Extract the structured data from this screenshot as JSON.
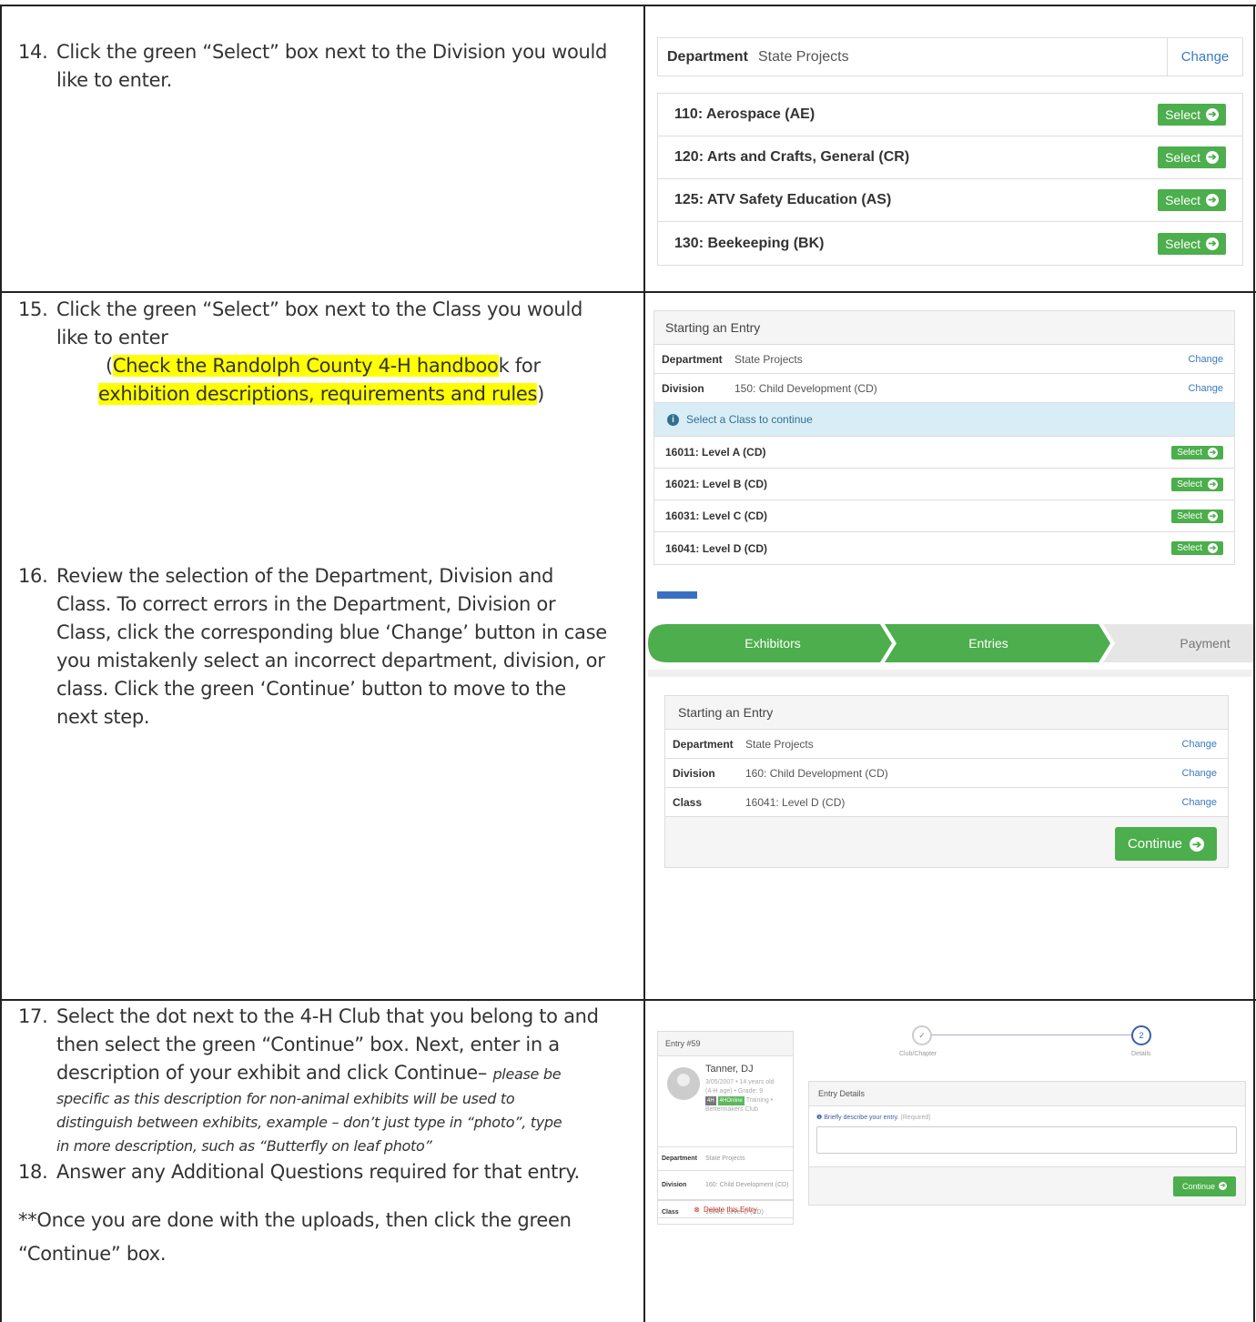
{
  "steps": {
    "s14": {
      "num": "14.",
      "line1": "Click the green “Select” box next to the Division you would",
      "line2": "like to enter."
    },
    "s15": {
      "num": "15.",
      "line1": "Click the green “Select” box next to the Class you would",
      "line2": "like to enter",
      "note_open": "(",
      "note_hl1": "Check the Randolph County 4-H  handboo",
      "note_plain": "k for",
      "note_hl2": "exhibition descriptions, requirements and rules",
      "note_close": ")"
    },
    "s16": {
      "num": "16.",
      "lines": [
        "Review the selection of the Department, Division and",
        "Class.  To correct errors in the Department, Division or",
        "Class, click the corresponding blue ‘Change’ button in case",
        "you mistakenly select an incorrect department, division, or",
        "class. Click the green ‘Continue’ button to move to the",
        "next step."
      ]
    },
    "s17": {
      "num": "17.",
      "lines": [
        "Select the dot next to the 4-H Club that you belong to and",
        "then select the green “Continue” box. Next, enter in a"
      ],
      "line3a": "description of your exhibit  and click Continue– ",
      "line3b": "please be",
      "ital": [
        "specific as this description for non-animal exhibits will be used to",
        "distinguish between exhibits, example – don’t just type in “photo”, type",
        "in more description, such as “Butterfly on leaf photo”"
      ]
    },
    "s18": {
      "num": "18.",
      "line": "Answer any Additional Questions required for that entry."
    },
    "final": {
      "line1": "**Once you are done with the uploads, then click the green",
      "line2": "“Continue” box."
    }
  },
  "panel1": {
    "dept_label": "Department",
    "dept_value": "State Projects",
    "change": "Change",
    "select": "Select",
    "divisions": [
      "110: Aerospace (AE)",
      "120: Arts and Crafts, General (CR)",
      "125: ATV Safety Education (AS)",
      "130: Beekeeping (BK)"
    ]
  },
  "panel2": {
    "title": "Starting an Entry",
    "dept_label": "Department",
    "dept_value": "State Projects",
    "div_label": "Division",
    "div_value": "150: Child Development (CD)",
    "change": "Change",
    "info": "Select a Class to continue",
    "select": "Select",
    "classes": [
      "16011: Level A (CD)",
      "16021: Level B (CD)",
      "16031: Level C (CD)",
      "16041: Level D (CD)"
    ]
  },
  "progress": {
    "steps": [
      "Exhibitors",
      "Entries",
      "Payment"
    ],
    "colors": {
      "done": "#4cae4c",
      "todo": "#e6e6e6"
    }
  },
  "panel3": {
    "title": "Starting an Entry",
    "dept_label": "Department",
    "dept_value": "State Projects",
    "div_label": "Division",
    "div_value": "160: Child Development (CD)",
    "class_label": "Class",
    "class_value": "16041: Level D (CD)",
    "change": "Change",
    "continue": "Continue"
  },
  "panel4": {
    "entry_title": "Entry #59",
    "name": "Tanner, DJ",
    "meta1": "3/05/2007 • 14 years old",
    "meta2": "(4-H age) • Grade: 9",
    "badge1": "4H",
    "badge2": "4HOnline",
    "meta3": "Training •",
    "meta4": "Bettermakers Club",
    "dept_label": "Department",
    "dept_value": "State Projects",
    "div_label": "Division",
    "div_value": "160: Child Development (CD)",
    "class_label": "Class",
    "class_value": "16041: Level D (CD)",
    "delete": "Delete this Entry",
    "step1_label": "Club/Chapter",
    "step2_label": "Details",
    "step2_num": "2",
    "details_title": "Entry Details",
    "hint": "Briefly describe your entry.",
    "required": "(Required)",
    "continue": "Continue"
  },
  "colors": {
    "green": "#4cae4c",
    "link": "#3a79c2",
    "highlight": "#ffff00"
  }
}
